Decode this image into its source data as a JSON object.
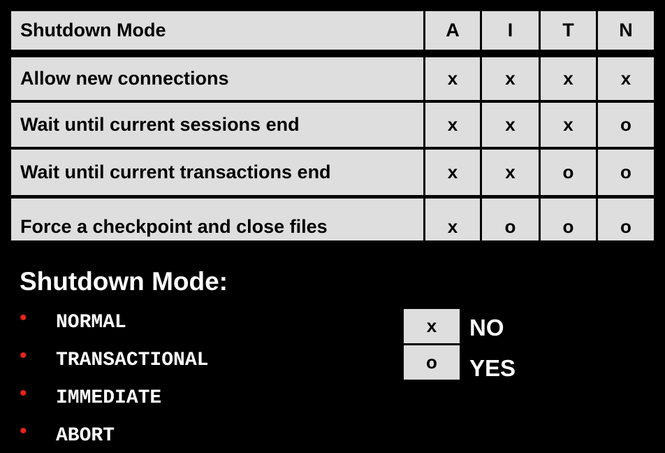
{
  "table": {
    "header": {
      "label": "Shutdown Mode",
      "columns": [
        "A",
        "I",
        "T",
        "N"
      ]
    },
    "rows": [
      {
        "label": "Allow new connections",
        "values": [
          "x",
          "x",
          "x",
          "x"
        ]
      },
      {
        "label": "Wait until current sessions end",
        "values": [
          "x",
          "x",
          "x",
          "o"
        ]
      },
      {
        "label": "Wait until current transactions end",
        "values": [
          "x",
          "x",
          "o",
          "o"
        ]
      },
      {
        "label": "Force a checkpoint and close files",
        "values": [
          "x",
          "o",
          "o",
          "o"
        ]
      }
    ]
  },
  "modes": {
    "heading": "Shutdown Mode:",
    "items": [
      "NORMAL",
      "TRANSACTIONAL",
      "IMMEDIATE",
      "ABORT"
    ]
  },
  "legend": [
    {
      "symbol": "x",
      "meaning": "NO"
    },
    {
      "symbol": "o",
      "meaning": "YES"
    }
  ],
  "colors": {
    "background": "#000000",
    "cell": "#dedede",
    "bullet": "#e8231a",
    "text_light": "#ffffff"
  }
}
